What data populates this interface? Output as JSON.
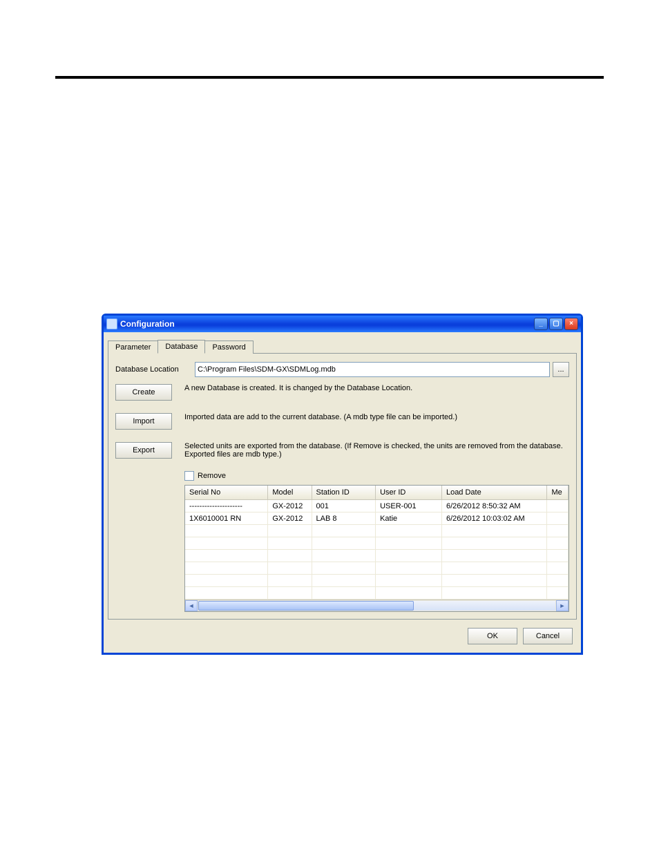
{
  "window": {
    "title": "Configuration"
  },
  "tabs": [
    {
      "label": "Parameter"
    },
    {
      "label": "Database"
    },
    {
      "label": "Password"
    }
  ],
  "db": {
    "location_label": "Database Location",
    "location_value": "C:\\Program Files\\SDM-GX\\SDMLog.mdb",
    "browse_label": "..."
  },
  "actions": {
    "create": {
      "label": "Create",
      "desc": "A new Database is created. It is changed by the Database Location."
    },
    "import": {
      "label": "Import",
      "desc": "Imported data are add to the current database. (A mdb type file can be imported.)"
    },
    "export": {
      "label": "Export",
      "desc": "Selected units are exported from the database. (If Remove is checked, the units are removed from the database. Exported files are mdb type.)"
    }
  },
  "remove_label": "Remove",
  "table": {
    "columns": [
      "Serial No",
      "Model",
      "Station ID",
      "User ID",
      "Load Date",
      "Me"
    ],
    "rows": [
      {
        "serial": "---------------------",
        "model": "GX-2012",
        "station": "001",
        "user": "USER-001",
        "load": "6/26/2012 8:50:32 AM"
      },
      {
        "serial": "1X6010001 RN",
        "model": "GX-2012",
        "station": "LAB 8",
        "user": "Katie",
        "load": "6/26/2012 10:03:02 AM"
      }
    ]
  },
  "buttons": {
    "ok": "OK",
    "cancel": "Cancel"
  }
}
